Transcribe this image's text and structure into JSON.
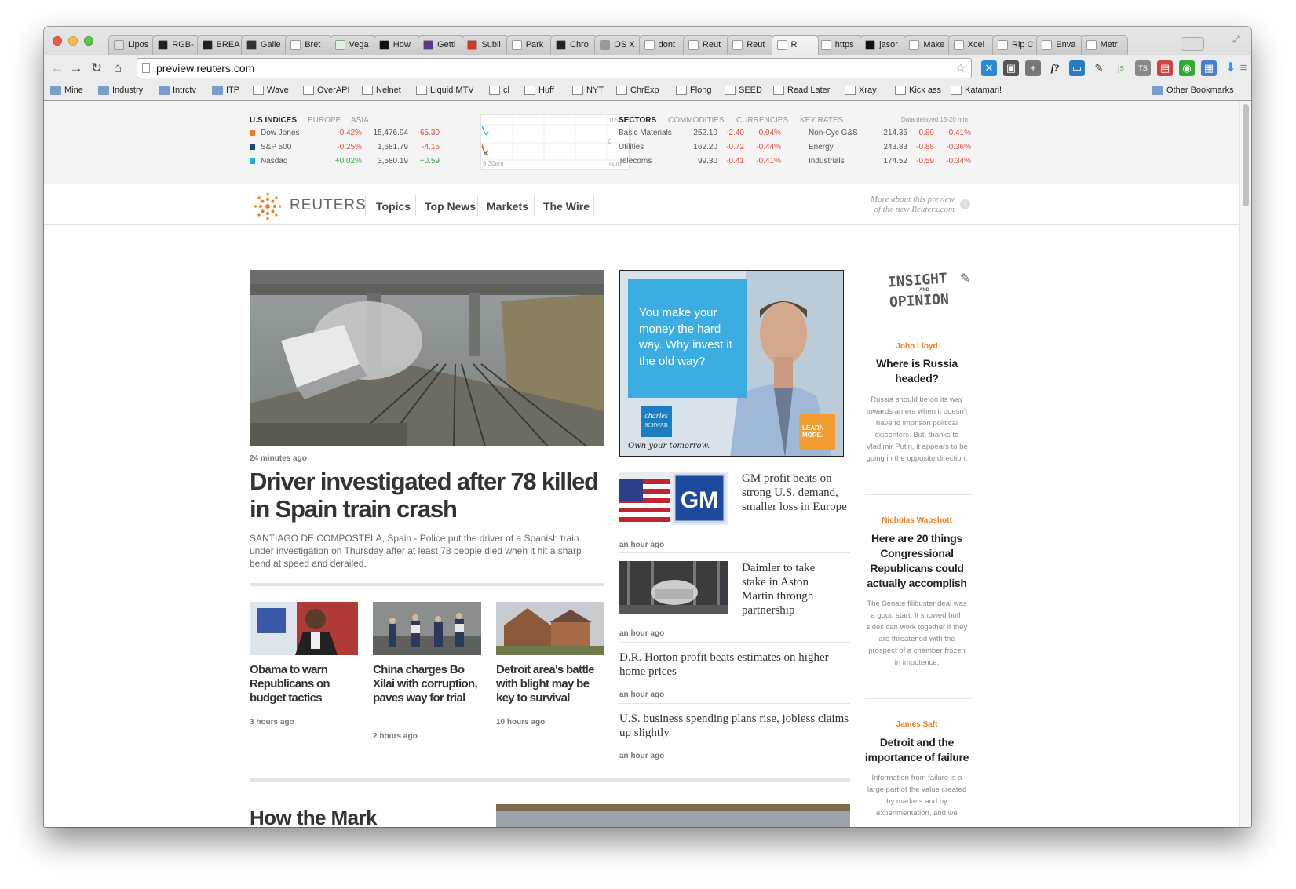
{
  "browser": {
    "tabs": [
      "Lipos",
      "RGB-",
      "BREA",
      "Galle",
      "Bret",
      "Vega",
      "How",
      "Getti",
      "Subli",
      "Park",
      "Chro",
      "OS X",
      "dont",
      "Reut",
      "Reut",
      "R",
      "https",
      "jasor",
      "Make",
      "Xcel",
      "Rip C",
      "Enva",
      "Metr"
    ],
    "url": "preview.reuters.com",
    "bookmarks": [
      "Mine",
      "Industry",
      "Intrctv",
      "ITP",
      "Wave",
      "OverAPI",
      "Nelnet",
      "Liquid MTV",
      "cl",
      "Huff",
      "NYT",
      "ChrExp",
      "Flong",
      "SEED",
      "Read Later",
      "Xray",
      "Kick ass",
      "Katamari!"
    ],
    "other_bookmarks": "Other Bookmarks"
  },
  "ticker": {
    "left_tabs": [
      "U.S INDICES",
      "EUROPE",
      "ASIA"
    ],
    "indices": [
      {
        "name": "Dow Jones",
        "pct": "-0.42%",
        "value": "15,476.94",
        "change": "-65.30",
        "color": "#f07d1a"
      },
      {
        "name": "S&P 500",
        "pct": "-0.25%",
        "value": "1,681.79",
        "change": "-4.15",
        "color": "#1b4a7a"
      },
      {
        "name": "Nasdaq",
        "pct": "+0.02%",
        "value": "3,580.19",
        "change": "+0.59",
        "color": "#1ab0e0"
      }
    ],
    "chart": {
      "top": "0.5%",
      "mid": "0",
      "start": "9:30am",
      "end": "4pm"
    },
    "right_tabs": [
      "SECTORS",
      "COMMODITIES",
      "CURRENCIES",
      "KEY RATES"
    ],
    "delay": "Data delayed 15-20 min",
    "sectors": [
      [
        {
          "name": "Basic Materials",
          "value": "252.10",
          "change": "-2.40",
          "pct": "-0.94%"
        },
        {
          "name": "Non-Cyc G&S",
          "value": "214.35",
          "change": "-0.89",
          "pct": "-0.41%"
        }
      ],
      [
        {
          "name": "Utilities",
          "value": "162.20",
          "change": "-0.72",
          "pct": "-0.44%"
        },
        {
          "name": "Energy",
          "value": "243.83",
          "change": "-0.88",
          "pct": "-0.36%"
        }
      ],
      [
        {
          "name": "Telecoms",
          "value": "99.30",
          "change": "-0.41",
          "pct": "-0.41%"
        },
        {
          "name": "Industrials",
          "value": "174.52",
          "change": "-0.59",
          "pct": "-0.34%"
        }
      ]
    ]
  },
  "nav": {
    "logo": "REUTERS",
    "links": [
      "Topics",
      "Top News",
      "Markets",
      "The Wire"
    ],
    "preview_note_1": "More about this preview",
    "preview_note_2": "of the new Reuters.com"
  },
  "lead": {
    "time": "24 minutes ago",
    "headline": "Driver investigated after 78 killed in Spain train crash",
    "summary": "SANTIAGO DE COMPOSTELA, Spain - Police put the driver of a Spanish train under investigation on Thursday after at least 78 people died when it hit a sharp bend at speed and derailed."
  },
  "secondary": [
    {
      "headline": "Obama to warn Republicans on budget tactics",
      "time": "3 hours ago"
    },
    {
      "headline": "China charges Bo Xilai with corruption, paves way for trial",
      "time": "2 hours ago"
    },
    {
      "headline": "Detroit area's battle with blight may be key to survival",
      "time": "10 hours ago"
    }
  ],
  "ad": {
    "copy": "You make your money the hard way. Why invest it the old way?",
    "brand_1": "charles",
    "brand_2": "SCHWAB",
    "cta_1": "LEARN",
    "cta_2": "MORE.",
    "tagline": "Own your tomorrow."
  },
  "news_list": [
    {
      "headline": "GM profit beats on strong U.S. demand, smaller loss in Europe",
      "time": "an hour ago"
    },
    {
      "headline": "Daimler to take stake in Aston Martin through partnership",
      "time": "an hour ago"
    },
    {
      "headline": "D.R. Horton profit beats estimates on higher home prices",
      "time": "an hour ago"
    },
    {
      "headline": "U.S. business spending plans rise, jobless claims up slightly",
      "time": "an hour ago"
    }
  ],
  "insight": {
    "title_1": "INSIGHT",
    "title_and": "AND",
    "title_2": "OPINION",
    "items": [
      {
        "author": "John Lloyd",
        "headline": "Where is Russia headed?",
        "body": "Russia should be on its way towards an era when it doesn't have to imprison political dissenters. But, thanks to Vladimir Putin, it appears to be going in the opposite direction."
      },
      {
        "author": "Nicholas Wapshott",
        "headline": "Here are 20 things Congressional Republicans could actually accomplish",
        "body": "The Senate filibuster deal was a good start. It showed both sides can work together if they are threatened with the prospect of a chamber frozen in impotence."
      },
      {
        "author": "James Saft",
        "headline": "Detroit and the importance of failure",
        "body": "Information from failure is a large part of the value created by markets and by experimentation, and we"
      }
    ]
  },
  "next_section": {
    "heading": "How the Mark"
  }
}
